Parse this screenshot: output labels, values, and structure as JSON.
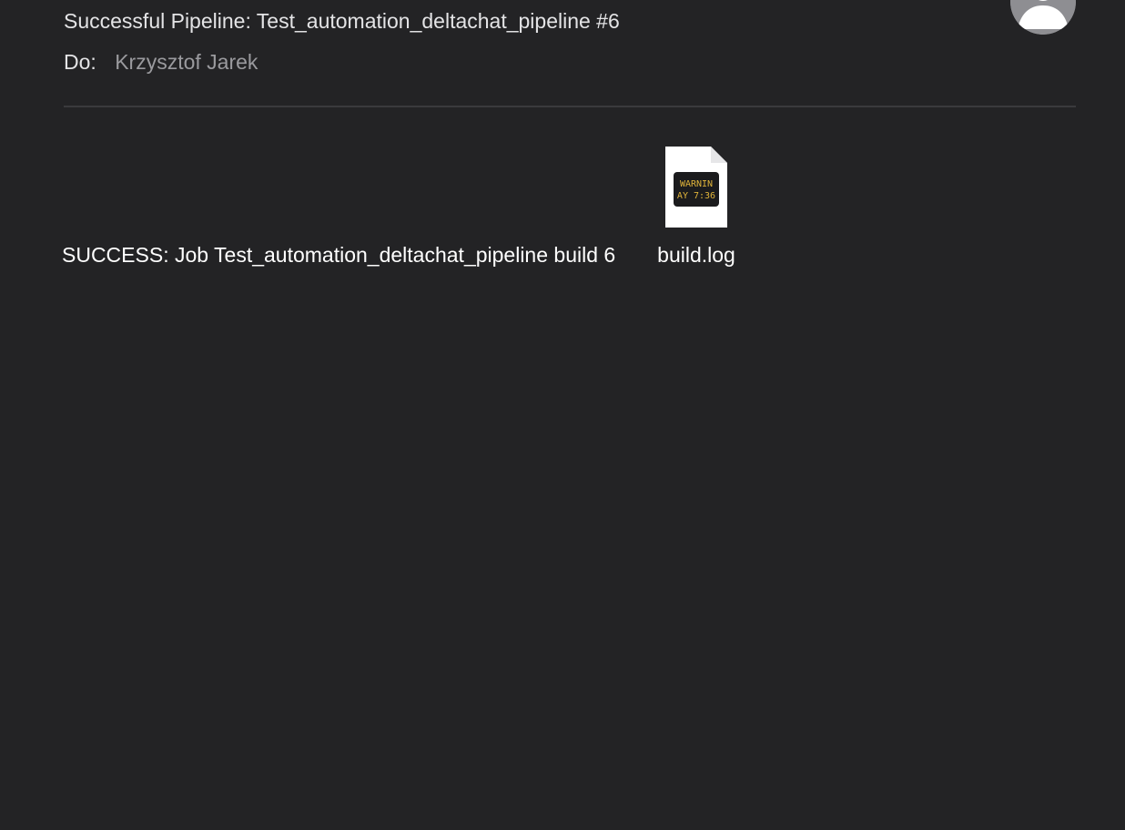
{
  "email": {
    "subject": "Successful Pipeline: Test_automation_deltachat_pipeline #6",
    "to_label": "Do:",
    "to_value": "Krzysztof Jarek",
    "body": "SUCCESS: Job Test_automation_deltachat_pipeline build 6"
  },
  "attachment": {
    "file_name": "build.log",
    "preview_line1": "WARNIN",
    "preview_line2": "AY 7:36",
    "icon": "console-log-file-icon"
  },
  "avatar": {
    "icon": "person-avatar-icon"
  },
  "colors": {
    "background": "#232325",
    "primary_text": "#e4e4e6",
    "secondary_text": "#9a9a9e",
    "console_text": "#e0b43a"
  }
}
